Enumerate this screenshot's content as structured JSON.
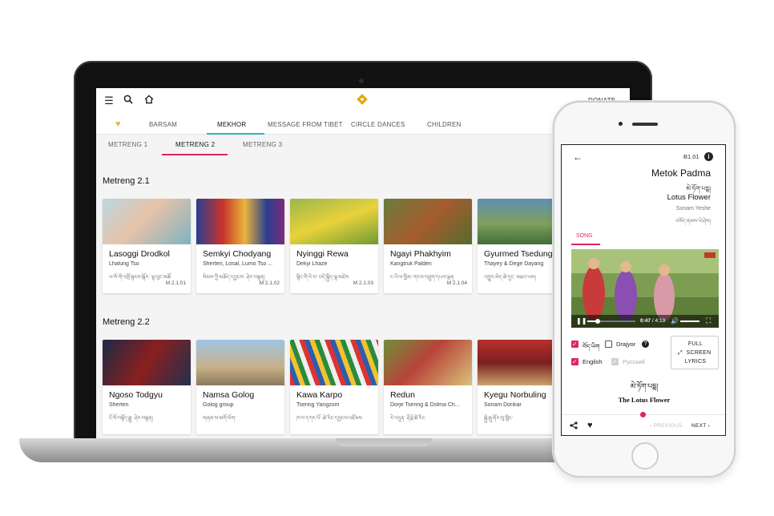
{
  "app": {
    "logo_icon": "endless-knot-icon",
    "menu_icon": "hamburger-icon",
    "search_icon": "search-icon",
    "home_icon": "home-icon",
    "donate_label": "DONATE",
    "accent_color": "#e0245e",
    "tab_accent_color": "#2bb3c0"
  },
  "main_tabs": [
    {
      "label": "BARSAM"
    },
    {
      "label": "MEKHOR"
    },
    {
      "label": "MESSAGE FROM TIBET"
    },
    {
      "label": "CIRCLE DANCES"
    },
    {
      "label": "CHILDREN"
    }
  ],
  "main_tabs_active": "MEKHOR",
  "sub_tabs": [
    {
      "label": "METRENG 1"
    },
    {
      "label": "METRENG 2"
    },
    {
      "label": "METRENG 3"
    }
  ],
  "sub_tabs_active": "METRENG 2",
  "sections": [
    {
      "title": "Metreng 2.1",
      "cards": [
        {
          "title": "Lasoggi Drodkol",
          "artist": "Lhalung Tso",
          "tibetan": "ལ་སོ་གི་འགྲོ་སྟངས་སྐོར་ ལྷ་ལུང་མཚོ",
          "code": "M 2.1.01"
        },
        {
          "title": "Semkyi Chodyang",
          "artist": "Sherten, Losal, Lumo Tso ...",
          "tibetan": "སེམས་ཀྱི་མཆོད་དབྱངས་ ཤེར་བསྟན།",
          "code": "M 2.1.02"
        },
        {
          "title": "Nyinggi Rewa",
          "artist": "Dekyi Lhaze",
          "tibetan": "སྙིང་གི་རེ་བ་ བདེ་སྐྱིད་ལྷ་མཛེས",
          "code": "M 2.1.03"
        },
        {
          "title": "Ngayi Phakhyim",
          "artist": "Kangtruk Palden",
          "tibetan": "ང་ཡི་ཕ་ཁྱིམ་ གངས་འབྲུག་དཔལ་ལྡན",
          "code": "M 2.1.04"
        },
        {
          "title": "Gyurmed Tsedung",
          "artist": "Thayey & Dege Dayang",
          "tibetan": "འགྱུར་མེད་ཚེ་དུང་ མཐའ་ཡས།",
          "code": ""
        }
      ]
    },
    {
      "title": "Metreng 2.2",
      "cards": [
        {
          "title": "Ngoso  Todgyu",
          "artist": "Sherten",
          "tibetan": "ངོ་སོ་བསྟོད་རྒྱུ་ ཤེར་བསྟན།",
          "code": ""
        },
        {
          "title": "Namsa  Golog",
          "artist": "Golog group",
          "tibetan": "གནམ་ས་མགོ་ལོག་",
          "code": ""
        },
        {
          "title": "Kawa Karpo",
          "artist": "Tsering Yangzom",
          "tibetan": "ཁ་བ་དཀར་པོ་ ཚེ་རིང་དབྱངས་འཛོམས",
          "code": ""
        },
        {
          "title": "Redun",
          "artist": "Dorje Tsering & Dolma Ch...",
          "tibetan": "རེ་འདུན་ རྡོ་རྗེ་ཚེ་རིང་",
          "code": ""
        },
        {
          "title": "Kyegu Norbuling",
          "artist": "Sonam Donkar",
          "tibetan": "སྐྱེ་རྒུ་ནོར་བུ་གླིང་",
          "code": ""
        }
      ]
    }
  ],
  "phone": {
    "code": "B1.01",
    "title": "Metok Padma",
    "title_tibetan": "མེ་ཏོག་པདྨ།",
    "english_title": "Lotus Flower",
    "artist": "Sonam Yeshe",
    "artist_tibetan": "བསོད་ནམས་ཡེ་ཤེས།",
    "tab_label": "SONG",
    "video": {
      "time": "0:47",
      "duration": "4:13",
      "progress": 0.19
    },
    "options": {
      "tibetan_label": "བོད་ཡིག",
      "drajyor_label": "Drajyor",
      "english_label": "English",
      "russian_label": "Русский"
    },
    "full_screen": {
      "line1": "FULL",
      "line2": "SCREEN",
      "line3": "LYRICS"
    },
    "lyric_tibetan": "མེ་ཏོག་པདྨ།",
    "lyric_english": "The Lotus Flower",
    "previous_label": "PREVIOUS",
    "next_label": "NEXT"
  }
}
